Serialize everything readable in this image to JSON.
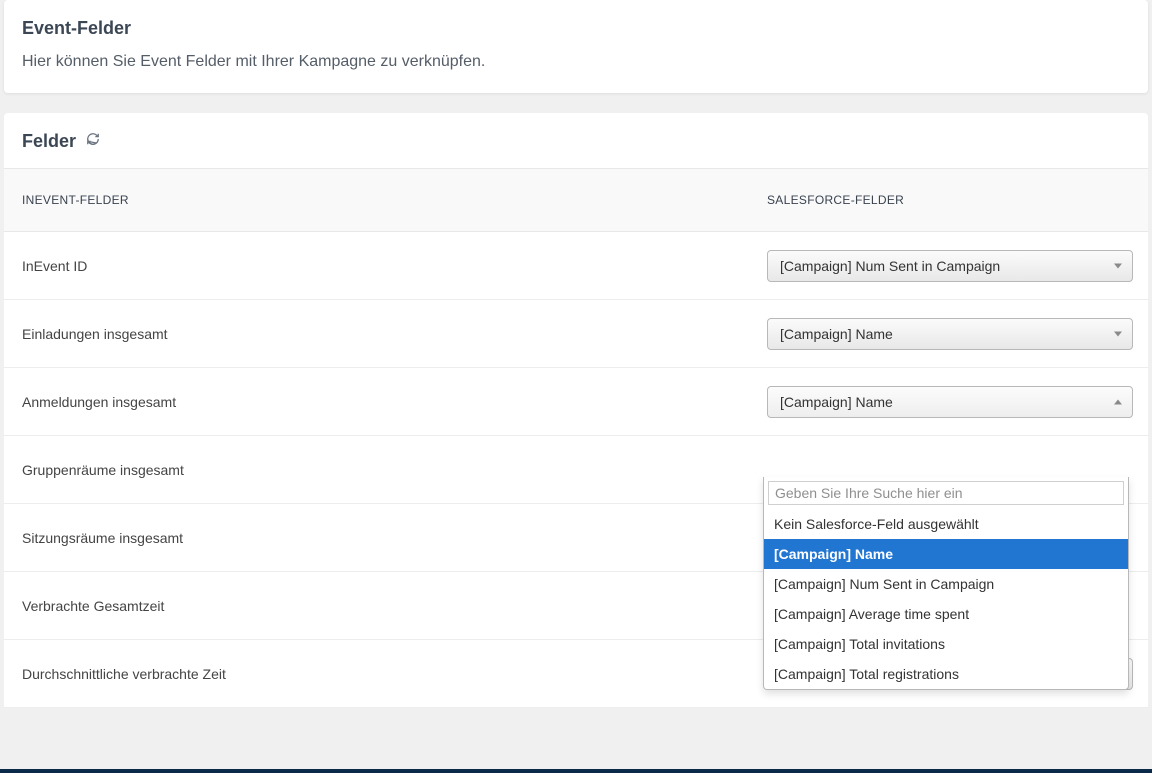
{
  "header": {
    "title": "Event-Felder",
    "subtitle": "Hier können Sie Event Felder mit Ihrer Kampagne zu verknüpfen."
  },
  "fields_section": {
    "title": "Felder",
    "columns": {
      "left": "INEVENT-FELDER",
      "right": "SALESFORCE-FELDER"
    }
  },
  "rows": [
    {
      "label": "InEvent ID",
      "value": "[Campaign] Num Sent in Campaign",
      "open": false
    },
    {
      "label": "Einladungen insgesamt",
      "value": "[Campaign] Name",
      "open": false
    },
    {
      "label": "Anmeldungen insgesamt",
      "value": "[Campaign] Name",
      "open": true
    },
    {
      "label": "Gruppenräume insgesamt",
      "value": "",
      "open": false,
      "hidden_control": true
    },
    {
      "label": "Sitzungsräume insgesamt",
      "value": "",
      "open": false,
      "hidden_control": true
    },
    {
      "label": "Verbrachte Gesamtzeit",
      "value": "",
      "open": false,
      "hidden_control": true
    },
    {
      "label": "Durchschnittliche verbrachte Zeit",
      "value": "Kein Salesforce-Feld ausgewählt",
      "open": false
    }
  ],
  "dropdown": {
    "search_placeholder": "Geben Sie Ihre Suche hier ein",
    "options": [
      "Kein Salesforce-Feld ausgewählt",
      "[Campaign] Name",
      "[Campaign] Num Sent in Campaign",
      "[Campaign] Average time spent",
      "[Campaign] Total invitations",
      "[Campaign] Total registrations"
    ],
    "selected_index": 1
  }
}
